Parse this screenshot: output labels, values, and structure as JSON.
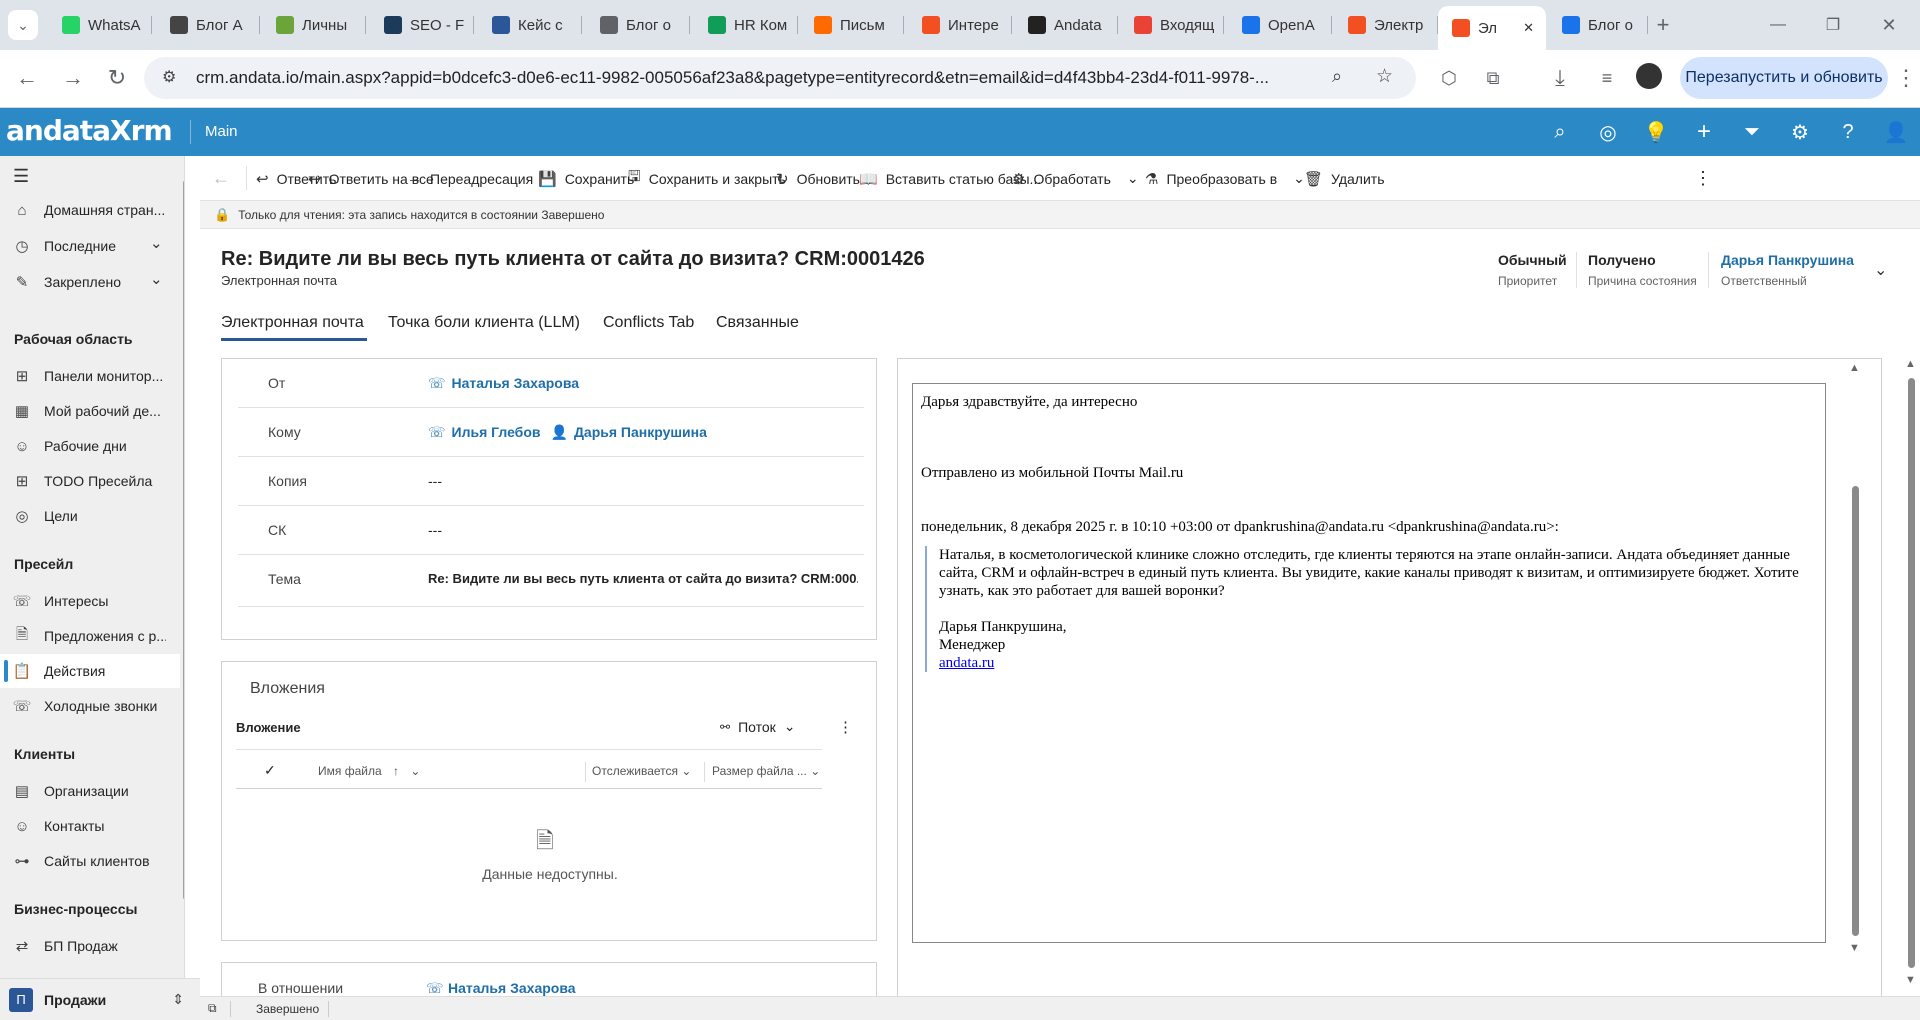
{
  "browser": {
    "tabs": [
      {
        "label": "WhatsA",
        "icon": "whatsapp-icon",
        "color": "#25d366"
      },
      {
        "label": "Блог А",
        "icon": "openai-icon",
        "color": "#444444"
      },
      {
        "label": "Личны",
        "icon": "sk-icon",
        "color": "#6ba539"
      },
      {
        "label": "SEO - F",
        "icon": "cloud-icon",
        "color": "#1c3b5a"
      },
      {
        "label": "Кейс с",
        "icon": "word-icon",
        "color": "#2b579a"
      },
      {
        "label": "Блог о",
        "icon": "globe-icon",
        "color": "#5f6368"
      },
      {
        "label": "HR Ком",
        "icon": "sheets-icon",
        "color": "#0f9d58"
      },
      {
        "label": "Письм",
        "icon": "mail-icon",
        "color": "#ff6a00"
      },
      {
        "label": "Интере",
        "icon": "ms-icon",
        "color": "#f25022"
      },
      {
        "label": "Andata",
        "icon": "amazon-icon",
        "color": "#222222"
      },
      {
        "label": "Входящ",
        "icon": "gmail-icon",
        "color": "#ea4335"
      },
      {
        "label": "OpenA",
        "icon": "sei-icon",
        "color": "#1a73e8"
      },
      {
        "label": "Электр",
        "icon": "ms-icon",
        "color": "#f25022"
      },
      {
        "label": "Эл",
        "icon": "ms-icon",
        "color": "#f25022",
        "active": true
      },
      {
        "label": "Блог о",
        "icon": "a-icon",
        "color": "#1a73e8"
      }
    ],
    "url": "crm.andata.io/main.aspx?appid=b0dcefc3-d0e6-ec11-9982-005056af23a8&pagetype=entityrecord&etn=email&id=d4f43bb4-23d4-f011-9978-...",
    "relaunch_label": "Перезапустить и обновить"
  },
  "crm": {
    "logo_text": "andataXrm",
    "app_label": "Main",
    "accent_color": "#2b8ac6"
  },
  "sidebar": {
    "items_top": [
      {
        "label": "Домашняя стран...",
        "icon": "home-icon"
      },
      {
        "label": "Последние",
        "icon": "clock-icon",
        "chevron": true
      },
      {
        "label": "Закреплено",
        "icon": "pin-icon",
        "chevron": true
      }
    ],
    "groups": [
      {
        "title": "Рабочая область",
        "items": [
          {
            "label": "Панели монитор...",
            "icon": "dashboard-icon"
          },
          {
            "label": "Мой рабочий де...",
            "icon": "calendar-icon"
          },
          {
            "label": "Рабочие дни",
            "icon": "person-icon"
          },
          {
            "label": "TODO Пресейла",
            "icon": "dashboard-icon"
          },
          {
            "label": "Цели",
            "icon": "target-icon"
          }
        ]
      },
      {
        "title": "Пресейл",
        "items": [
          {
            "label": "Интересы",
            "icon": "phone-icon"
          },
          {
            "label": "Предложения с р...",
            "icon": "doc-icon"
          },
          {
            "label": "Действия",
            "icon": "clipboard-icon",
            "selected": true
          },
          {
            "label": "Холодные звонки",
            "icon": "phone-icon"
          }
        ]
      },
      {
        "title": "Клиенты",
        "items": [
          {
            "label": "Организации",
            "icon": "building-icon"
          },
          {
            "label": "Контакты",
            "icon": "person-icon"
          },
          {
            "label": "Сайты клиентов",
            "icon": "sitemap-icon"
          }
        ]
      },
      {
        "title": "Бизнес-процессы",
        "items": [
          {
            "label": "БП Продаж",
            "icon": "flow-icon"
          }
        ]
      }
    ],
    "area": {
      "badge": "П",
      "label": "Продажи"
    }
  },
  "commands": [
    {
      "label": "Ответить",
      "icon": "reply-icon"
    },
    {
      "label": "Ответить на все",
      "icon": "reply-all-icon"
    },
    {
      "label": "Переадресация",
      "icon": "forward-icon"
    },
    {
      "label": "Сохранить",
      "icon": "save-icon"
    },
    {
      "label": "Сохранить и закрыть",
      "icon": "save-close-icon"
    },
    {
      "label": "Обновить",
      "icon": "refresh-icon"
    },
    {
      "label": "Вставить статью базы...",
      "icon": "book-icon"
    },
    {
      "label": "Обработать",
      "icon": "process-icon",
      "dropdown": true
    },
    {
      "label": "Преобразовать в",
      "icon": "convert-icon",
      "dropdown": true
    },
    {
      "label": "Удалить",
      "icon": "trash-icon"
    }
  ],
  "notice": "Только для чтения: эта запись находится в состоянии Завершено",
  "form": {
    "title": "Re: Видите ли вы весь путь клиента от сайта до визита? CRM:0001426",
    "entity": "Электронная почта",
    "header_fields": [
      {
        "value": "Обычный",
        "label": "Приоритет"
      },
      {
        "value": "Получено",
        "label": "Причина состояния"
      },
      {
        "value": "Дарья Панкрушина",
        "label": "Ответственный",
        "link": true
      }
    ],
    "tabs": [
      "Электронная почта",
      "Точка боли клиента (LLM)",
      "Conflicts Tab",
      "Связанные"
    ],
    "fields": {
      "from_label": "От",
      "from_value": "Наталья Захарова",
      "to_label": "Кому",
      "to_value1": "Илья Глебов",
      "to_value2": "Дарья Панкрушина",
      "cc_label": "Копия",
      "cc_value": "---",
      "bcc_label": "СК",
      "bcc_value": "---",
      "subject_label": "Тема",
      "subject_value": "Re: Видите ли вы весь путь клиента от сайта до визита? CRM:000..."
    },
    "attachments": {
      "section_title": "Вложения",
      "grid_title": "Вложение",
      "flow_label": "Поток",
      "columns": [
        "Имя файла",
        "Отслеживается",
        "Размер файла ..."
      ],
      "empty": "Данные недоступны."
    },
    "regarding_label": "В отношении",
    "regarding_value": "Наталья Захарова"
  },
  "email": {
    "line1": "Дарья здравствуйте, да интересно",
    "line2": "Отправлено из мобильной Почты Mail.ru",
    "line3": "понедельник, 8 декабря 2025 г. в 10:10 +03:00 от dpankrushina@andata.ru <dpankrushina@andata.ru>:",
    "quote_p1": "Наталья, в косметологической клинике сложно отследить, где клиенты теряются на этапе онлайн-записи. Андата объединяет данные сайта, CRM и офлайн-встреч в единый путь клиента. Вы увидите, какие каналы приводят к визитам, и оптимизируете бюджет. Хотите узнать, как это работает для вашей воронки?",
    "sig1": "Дарья Панкрушина,",
    "sig2": "Менеджер",
    "sig_link": "andata.ru"
  },
  "status": {
    "label": "Завершено"
  }
}
